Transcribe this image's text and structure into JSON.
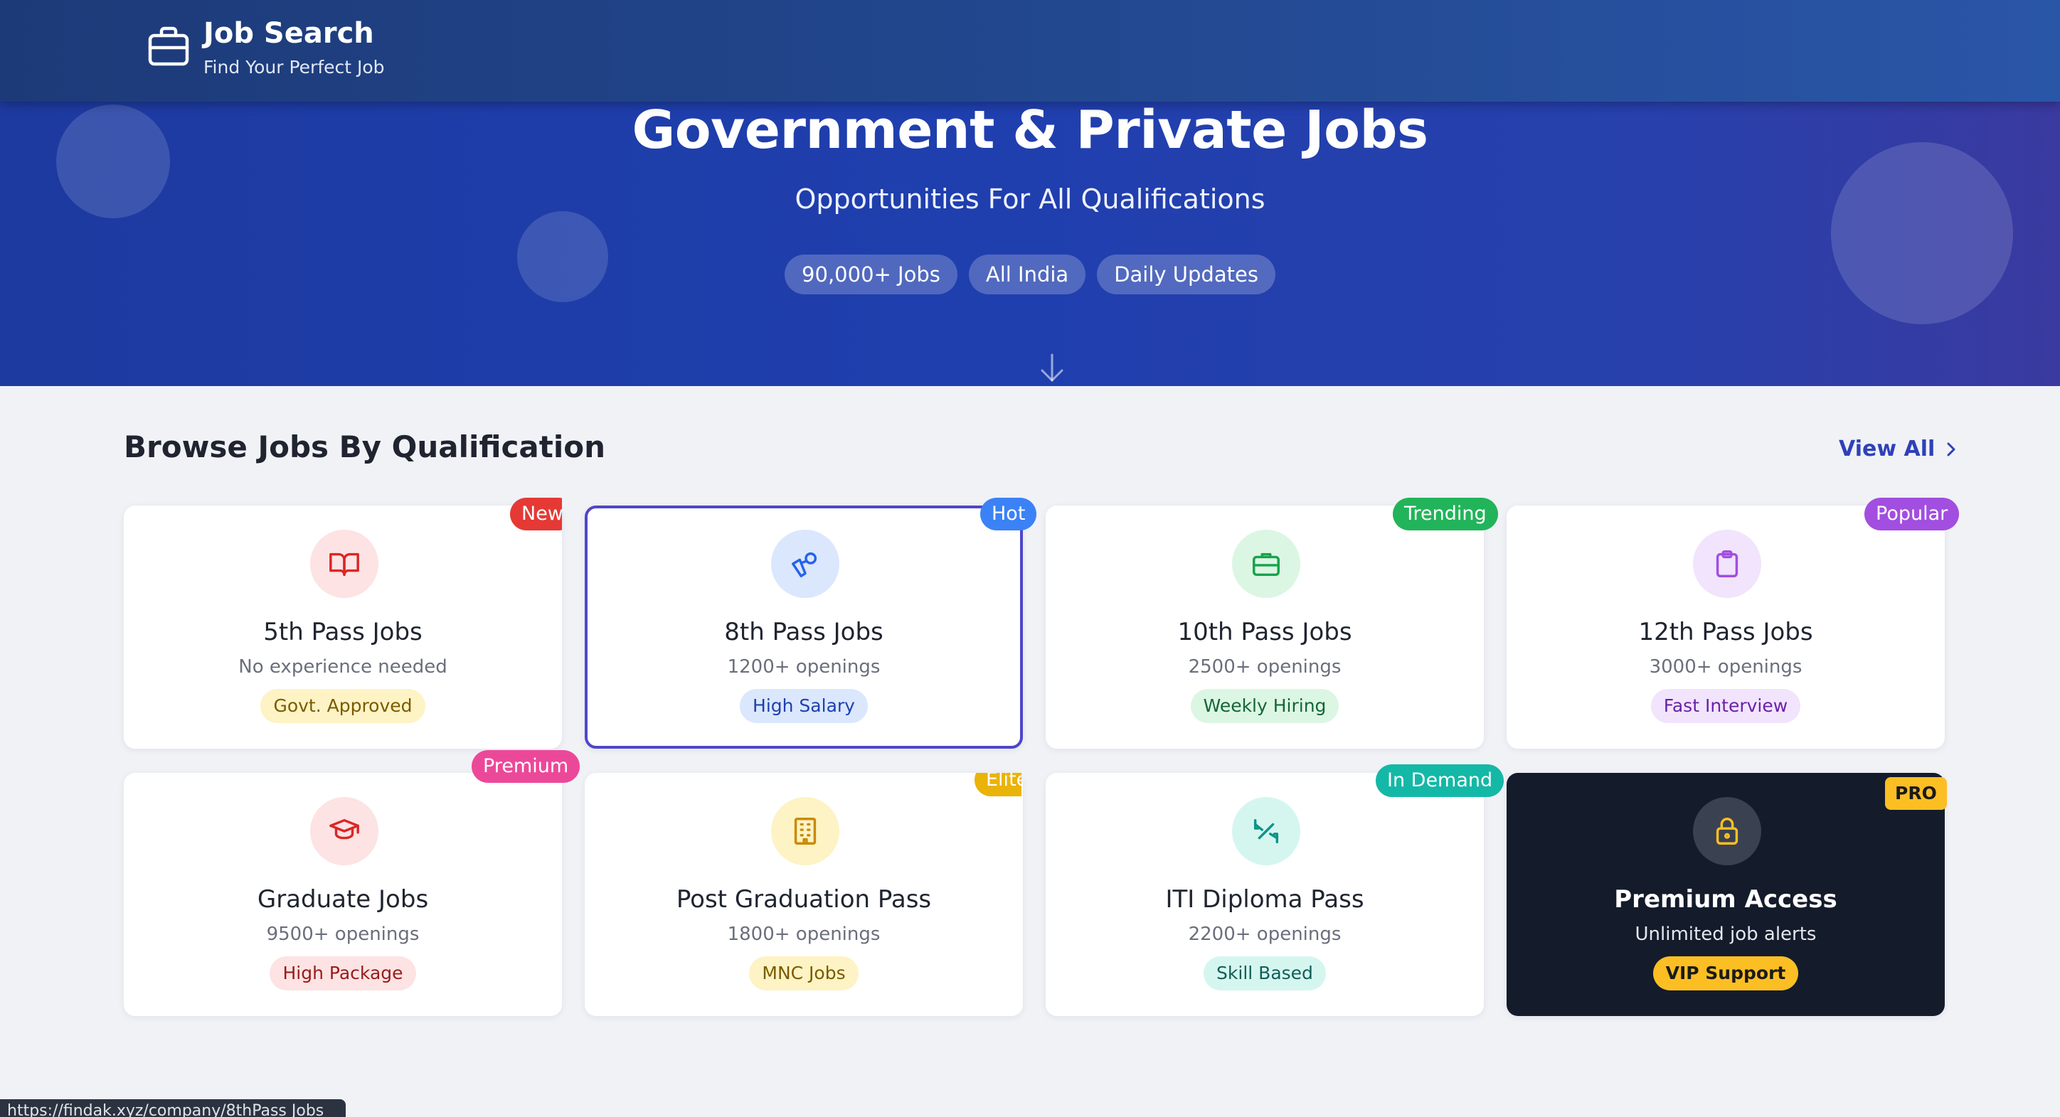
{
  "header": {
    "app_title": "Job Search",
    "app_subtitle": "Find Your Perfect Job",
    "logo_icon": "briefcase-icon"
  },
  "hero": {
    "title": "Government & Private Jobs",
    "subtitle": "Opportunities For All Qualifications",
    "pills": [
      "90,000+ Jobs",
      "All India",
      "Daily Updates"
    ],
    "scroll_icon": "arrow-down-icon"
  },
  "section": {
    "title": "Browse Jobs By Qualification",
    "view_all_label": "View All",
    "view_all_icon": "chevron-right-icon"
  },
  "cards": [
    {
      "title": "5th Pass Jobs",
      "desc": "No experience needed",
      "tag": "Govt. Approved",
      "badge": "New",
      "icon": "book-icon",
      "accent": "#e53935"
    },
    {
      "title": "8th Pass Jobs",
      "desc": "1200+ openings",
      "tag": "High Salary",
      "badge": "Hot",
      "icon": "pen-tool-icon",
      "accent": "#3b82f6"
    },
    {
      "title": "10th Pass Jobs",
      "desc": "2500+ openings",
      "tag": "Weekly Hiring",
      "badge": "Trending",
      "icon": "briefcase-icon",
      "accent": "#22b45a"
    },
    {
      "title": "12th Pass Jobs",
      "desc": "3000+ openings",
      "tag": "Fast Interview",
      "badge": "Popular",
      "icon": "clipboard-icon",
      "accent": "#a24ee0"
    },
    {
      "title": "Graduate Jobs",
      "desc": "9500+ openings",
      "tag": "High Package",
      "badge": "Premium",
      "icon": "graduation-cap-icon",
      "accent": "#ec4899"
    },
    {
      "title": "Post Graduation Pass",
      "desc": "1800+ openings",
      "tag": "MNC Jobs",
      "badge": "Elite",
      "icon": "building-icon",
      "accent": "#eab308"
    },
    {
      "title": "ITI Diploma Pass",
      "desc": "2200+ openings",
      "tag": "Skill Based",
      "badge": "In Demand",
      "icon": "tools-icon",
      "accent": "#14b8a6"
    },
    {
      "title": "Premium Access",
      "desc": "Unlimited job alerts",
      "tag": "VIP Support",
      "badge": "PRO",
      "icon": "lock-icon",
      "accent": "#fbbf24"
    }
  ],
  "status_bar": {
    "url": "https://findak.xyz/company/8thPass Jobs"
  }
}
